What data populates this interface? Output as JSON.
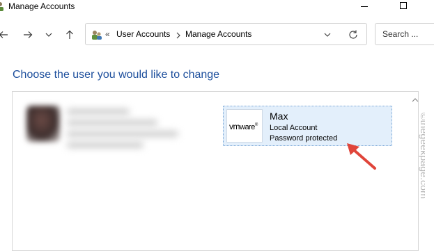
{
  "window": {
    "title": "Manage Accounts"
  },
  "nav": {
    "back_icon": "arrow-left-icon",
    "forward_icon": "arrow-right-icon",
    "recent_icon": "chevron-down-icon",
    "up_icon": "arrow-up-icon"
  },
  "address_bar": {
    "overflow": "«",
    "breadcrumbs": [
      "User Accounts",
      "Manage Accounts"
    ]
  },
  "search": {
    "placeholder": "Search ..."
  },
  "main": {
    "heading": "Choose the user you would like to change",
    "accounts": [
      {
        "logo_prefix": "vm",
        "logo_suffix": "ware",
        "logo_mark": "®",
        "name": "Max",
        "type": "Local Account",
        "status": "Password protected"
      }
    ]
  },
  "watermark": "©thegeekpage.com",
  "colors": {
    "heading": "#1c4e9c",
    "selection": "#e3effb",
    "arrow": "#e0453a"
  }
}
